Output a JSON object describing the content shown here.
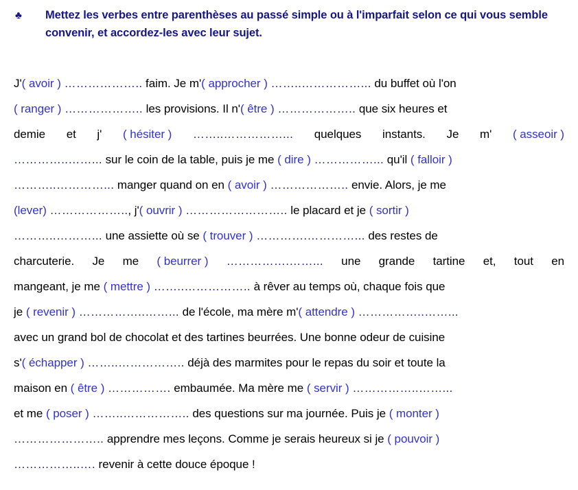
{
  "heading": {
    "bullet_icon": "club-suit-bullet",
    "bullet_glyph": "♣",
    "text": "Mettez les verbes entre parenthèses au passé simple ou à l'imparfait selon ce qui vous semble convenir, et accordez-les avec leur sujet.",
    "color": "#161687"
  },
  "colors": {
    "heading": "#161687",
    "verb": "#3232cd",
    "dots": "#191970",
    "body": "#000000",
    "background": "#ffffff"
  },
  "exercise": {
    "full_text": "J'( avoir ) ……………….. faim. Je m'( approcher ) ……..…………….. du buffet où l'on ( ranger ) ……………….. les provisions. Il n'( être ) ……………….. que six heures et demie et j'( hésiter ) ……..……………... quelques instants. Je m'( asseoir ) …………..…….. sur le coin de la table, puis je me ( dire ) …………….. qu'il ( falloir ) ………..………….. manger quand on en ( avoir ) ………………. envie. Alors, je me (lever) ……………….., j'( ouvrir ) …………………….. le placard et je ( sortir ) ………..……….. une assiette où se ( trouver ) ………….………….. des restes de charcuterie. Je me ( beurrer ) …………….…….. une grande tartine et, tout en mangeant, je me ( mettre ) ……..…………….. à rêver au temps où, chaque fois que je ( revenir ) ……………..…….. de l'école, ma mère m'( attendre ) ……………..…….. avec un grand bol de chocolat et des tartines beurrées. Une bonne odeur de cuisine s'( échapper ) ……..…………….. déjà des marmites pour le repas du soir et toute la maison en ( être ) ……………. embaumée. Ma mère me ( servir ) ……………..…….. et me ( poser ) ……..…………….. des questions sur ma journée. Puis je ( monter ) ………………….. apprendre mes leçons. Comme je serais heureux si je ( pouvoir ) ……………..…. revenir à cette douce époque !",
    "verbs": [
      "avoir",
      "approcher",
      "ranger",
      "être",
      "hésiter",
      "asseoir",
      "dire",
      "falloir",
      "avoir",
      "lever",
      "ouvrir",
      "sortir",
      "trouver",
      "beurrer",
      "mettre",
      "revenir",
      "attendre",
      "échapper",
      "être",
      "servir",
      "poser",
      "monter",
      "pouvoir"
    ],
    "blank_count": 23,
    "lines": [
      {
        "justify": false,
        "parts": [
          {
            "t": "plain",
            "v": "J'"
          },
          {
            "t": "verb",
            "v": "( avoir )"
          },
          {
            "t": "plain",
            "v": " "
          },
          {
            "t": "dots",
            "v": "……………….."
          },
          {
            "t": "plain",
            "v": " faim. Je m'"
          },
          {
            "t": "verb",
            "v": "( approcher )"
          },
          {
            "t": "plain",
            "v": " "
          },
          {
            "t": "dots",
            "v": "……..……………..."
          },
          {
            "t": "plain",
            "v": " du buffet où l'on"
          }
        ]
      },
      {
        "justify": false,
        "parts": [
          {
            "t": "verb",
            "v": "( ranger )"
          },
          {
            "t": "plain",
            "v": " "
          },
          {
            "t": "dots",
            "v": "……………….."
          },
          {
            "t": "plain",
            "v": " les provisions. Il n'"
          },
          {
            "t": "verb",
            "v": "( être )"
          },
          {
            "t": "plain",
            "v": " "
          },
          {
            "t": "dots",
            "v": "……………….."
          },
          {
            "t": "plain",
            "v": " que six heures et"
          }
        ]
      },
      {
        "justify": true,
        "parts": [
          {
            "t": "plain",
            "v": "demie"
          },
          {
            "t": "plain",
            "v": "et"
          },
          {
            "t": "plain",
            "v": "j'"
          },
          {
            "t": "verb",
            "v": "( hésiter )"
          },
          {
            "t": "dots",
            "v": "……..……………..."
          },
          {
            "t": "plain",
            "v": "quelques"
          },
          {
            "t": "plain",
            "v": "instants."
          },
          {
            "t": "plain",
            "v": "Je"
          },
          {
            "t": "plain",
            "v": "m'"
          },
          {
            "t": "verb",
            "v": "( asseoir )"
          }
        ]
      },
      {
        "justify": false,
        "parts": [
          {
            "t": "dots",
            "v": "…………..……..."
          },
          {
            "t": "plain",
            "v": " sur le coin de la table, puis je me "
          },
          {
            "t": "verb",
            "v": "( dire )"
          },
          {
            "t": "plain",
            "v": " "
          },
          {
            "t": "dots",
            "v": "……………..."
          },
          {
            "t": "plain",
            "v": " qu'il "
          },
          {
            "t": "verb",
            "v": "( falloir )"
          }
        ]
      },
      {
        "justify": false,
        "parts": [
          {
            "t": "dots",
            "v": "………..…………..."
          },
          {
            "t": "plain",
            "v": " manger quand on en "
          },
          {
            "t": "verb",
            "v": "( avoir )"
          },
          {
            "t": "plain",
            "v": " "
          },
          {
            "t": "dots",
            "v": "……………….."
          },
          {
            "t": "plain",
            "v": " envie. Alors, je me"
          }
        ]
      },
      {
        "justify": false,
        "parts": [
          {
            "t": "verb",
            "v": "(lever)"
          },
          {
            "t": "plain",
            "v": " "
          },
          {
            "t": "dots",
            "v": "……………….."
          },
          {
            "t": "plain",
            "v": ", j'"
          },
          {
            "t": "verb",
            "v": "( ouvrir )"
          },
          {
            "t": "plain",
            "v": " "
          },
          {
            "t": "dots",
            "v": "…………………….."
          },
          {
            "t": "plain",
            "v": " le placard et je "
          },
          {
            "t": "verb",
            "v": "( sortir )"
          }
        ]
      },
      {
        "justify": false,
        "parts": [
          {
            "t": "dots",
            "v": "………..………..."
          },
          {
            "t": "plain",
            "v": " une assiette où se "
          },
          {
            "t": "verb",
            "v": "( trouver )"
          },
          {
            "t": "plain",
            "v": " "
          },
          {
            "t": "dots",
            "v": "………….…………..."
          },
          {
            "t": "plain",
            "v": " des restes de"
          }
        ]
      },
      {
        "justify": true,
        "parts": [
          {
            "t": "plain",
            "v": "charcuterie."
          },
          {
            "t": "plain",
            "v": "Je"
          },
          {
            "t": "plain",
            "v": "me"
          },
          {
            "t": "verb",
            "v": "( beurrer )"
          },
          {
            "t": "dots",
            "v": "…………….……..."
          },
          {
            "t": "plain",
            "v": "une"
          },
          {
            "t": "plain",
            "v": "grande"
          },
          {
            "t": "plain",
            "v": "tartine"
          },
          {
            "t": "plain",
            "v": "et,"
          },
          {
            "t": "plain",
            "v": "tout"
          },
          {
            "t": "plain",
            "v": "en"
          }
        ]
      },
      {
        "justify": false,
        "parts": [
          {
            "t": "plain",
            "v": "mangeant, je me "
          },
          {
            "t": "verb",
            "v": "( mettre )"
          },
          {
            "t": "plain",
            "v": " "
          },
          {
            "t": "dots",
            "v": "……..…………….."
          },
          {
            "t": "plain",
            "v": " à rêver au temps où, chaque fois que"
          }
        ]
      },
      {
        "justify": false,
        "parts": [
          {
            "t": "plain",
            "v": "je "
          },
          {
            "t": "verb",
            "v": "( revenir )"
          },
          {
            "t": "plain",
            "v": " "
          },
          {
            "t": "dots",
            "v": "……………..……..."
          },
          {
            "t": "plain",
            "v": " de l'école, ma mère m'"
          },
          {
            "t": "verb",
            "v": "( attendre )"
          },
          {
            "t": "plain",
            "v": " "
          },
          {
            "t": "dots",
            "v": "……………..……..."
          }
        ]
      },
      {
        "justify": false,
        "parts": [
          {
            "t": "plain",
            "v": "avec un grand bol de chocolat et des tartines beurrées. Une bonne odeur de cuisine"
          }
        ]
      },
      {
        "justify": false,
        "parts": [
          {
            "t": "plain",
            "v": "s'"
          },
          {
            "t": "verb",
            "v": "( échapper )"
          },
          {
            "t": "plain",
            "v": " "
          },
          {
            "t": "dots",
            "v": "……..…………….."
          },
          {
            "t": "plain",
            "v": " déjà des marmites pour le repas du soir et toute la"
          }
        ]
      },
      {
        "justify": false,
        "parts": [
          {
            "t": "plain",
            "v": "maison en "
          },
          {
            "t": "verb",
            "v": "( être )"
          },
          {
            "t": "plain",
            "v": " "
          },
          {
            "t": "dots",
            "v": "……………."
          },
          {
            "t": "plain",
            "v": " embaumée. Ma mère me "
          },
          {
            "t": "verb",
            "v": "( servir )"
          },
          {
            "t": "plain",
            "v": " "
          },
          {
            "t": "dots",
            "v": "……………..……..."
          }
        ]
      },
      {
        "justify": false,
        "parts": [
          {
            "t": "plain",
            "v": "et me "
          },
          {
            "t": "verb",
            "v": "( poser )"
          },
          {
            "t": "plain",
            "v": " "
          },
          {
            "t": "dots",
            "v": "……..…………….."
          },
          {
            "t": "plain",
            "v": " des questions sur ma journée. Puis je "
          },
          {
            "t": "verb",
            "v": "( monter )"
          }
        ]
      },
      {
        "justify": false,
        "parts": [
          {
            "t": "dots",
            "v": "………………….."
          },
          {
            "t": "plain",
            "v": " apprendre mes leçons. Comme je serais heureux si je "
          },
          {
            "t": "verb",
            "v": "( pouvoir )"
          }
        ]
      },
      {
        "justify": false,
        "parts": [
          {
            "t": "dots",
            "v": "……………..…."
          },
          {
            "t": "plain",
            "v": " revenir à cette douce époque !"
          }
        ]
      }
    ]
  }
}
